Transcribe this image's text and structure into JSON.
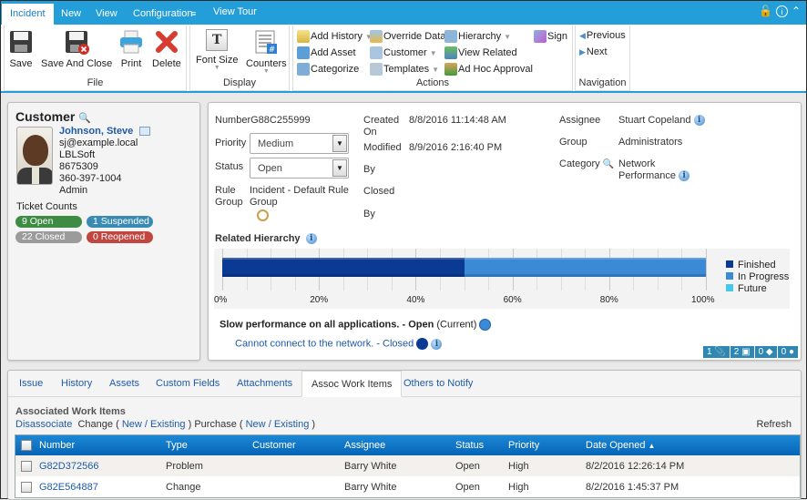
{
  "topnav": {
    "tabs": [
      "Incident",
      "New",
      "View",
      "Configuration"
    ],
    "view_tour": "View Tour",
    "icons": [
      "lock-icon",
      "info-icon",
      "collapse-icon"
    ]
  },
  "ribbon": {
    "file": {
      "label": "File",
      "buttons": [
        "Save",
        "Save And Close",
        "Print",
        "Delete"
      ]
    },
    "display": {
      "label": "Display",
      "buttons": [
        "Font Size",
        "Counters"
      ]
    },
    "actions": {
      "label": "Actions",
      "add_history": "Add History",
      "add_asset": "Add Asset",
      "categorize": "Categorize",
      "override_data": "Override Data",
      "customer": "Customer",
      "templates": "Templates",
      "hierarchy": "Hierarchy",
      "view_related": "View Related",
      "ad_hoc_approval": "Ad Hoc Approval",
      "sign": "Sign"
    },
    "navigation": {
      "label": "Navigation",
      "previous": "Previous",
      "next": "Next"
    }
  },
  "customer": {
    "title": "Customer",
    "name": "Johnson, Steve",
    "email": "sj@example.local",
    "company": "LBLSoft",
    "id": "8675309",
    "phone": "360-397-1004",
    "role": "Admin",
    "ticket_counts_label": "Ticket Counts",
    "counts": {
      "open": "9 Open",
      "suspended": "1 Suspended",
      "closed": "22 Closed",
      "reopened": "0 Reopened"
    },
    "colors": {
      "open": "#3e8b44",
      "suspended": "#3a8bb3",
      "closed": "#9b9b9b",
      "reopened": "#c0463f"
    }
  },
  "ticket": {
    "number_label": "Number",
    "number": "G88C255999",
    "priority_label": "Priority",
    "priority": "Medium",
    "status_label": "Status",
    "status": "Open",
    "rule_group_label_1": "Rule",
    "rule_group_label_2": "Group",
    "rule_group_1": "Incident - Default Rule",
    "rule_group_2": "Group",
    "created_label_1": "Created",
    "created_label_2": "On",
    "created": "8/8/2016 11:14:48 AM",
    "modified_label": "Modified",
    "modified": "8/9/2016 2:16:40 PM",
    "by_label": "By",
    "closed_label": "Closed",
    "closed_by_label": "By",
    "assignee_label": "Assignee",
    "assignee": "Stuart Copeland",
    "group_label": "Group",
    "group": "Administrators",
    "category_label": "Category",
    "category_1": "Network",
    "category_2": "Performance"
  },
  "hierarchy": {
    "title": "Related Hierarchy",
    "current_item": "Slow performance on all applications. - Open",
    "current_suffix": "(Current)",
    "related_item": "Cannot connect to the network. - Closed",
    "legend": [
      {
        "label": "Finished",
        "color": "#0a3a94"
      },
      {
        "label": "In Progress",
        "color": "#3a8ad6"
      },
      {
        "label": "Future",
        "color": "#45c8ee"
      }
    ],
    "ticks": [
      "0%",
      "20%",
      "40%",
      "60%",
      "80%",
      "100%"
    ],
    "finished_pct": 50,
    "in_progress_pct": 50,
    "future_pct": 0
  },
  "counters": {
    "attachments": "1",
    "assets": "2",
    "tags": "0",
    "users": "0"
  },
  "tabs": [
    "Issue",
    "History",
    "Assets",
    "Custom Fields",
    "Attachments",
    "Assoc Work Items",
    "Others to Notify"
  ],
  "work_items": {
    "title": "Associated Work Items",
    "disassociate": "Disassociate",
    "change": "Change (",
    "new": "New",
    "slash": "/",
    "existing": "Existing",
    "close_paren": ")",
    "purchase": "Purchase (",
    "refresh": "Refresh",
    "columns": [
      "Number",
      "Type",
      "Customer",
      "Assignee",
      "Status",
      "Priority",
      "Date Opened"
    ],
    "rows": [
      {
        "number": "G82D372566",
        "type": "Problem",
        "customer": "",
        "assignee": "Barry White",
        "status": "Open",
        "priority": "High",
        "date": "8/2/2016 12:26:14 PM"
      },
      {
        "number": "G82E564887",
        "type": "Change",
        "customer": "",
        "assignee": "Barry White",
        "status": "Open",
        "priority": "High",
        "date": "8/2/2016 1:45:37 PM"
      }
    ]
  }
}
